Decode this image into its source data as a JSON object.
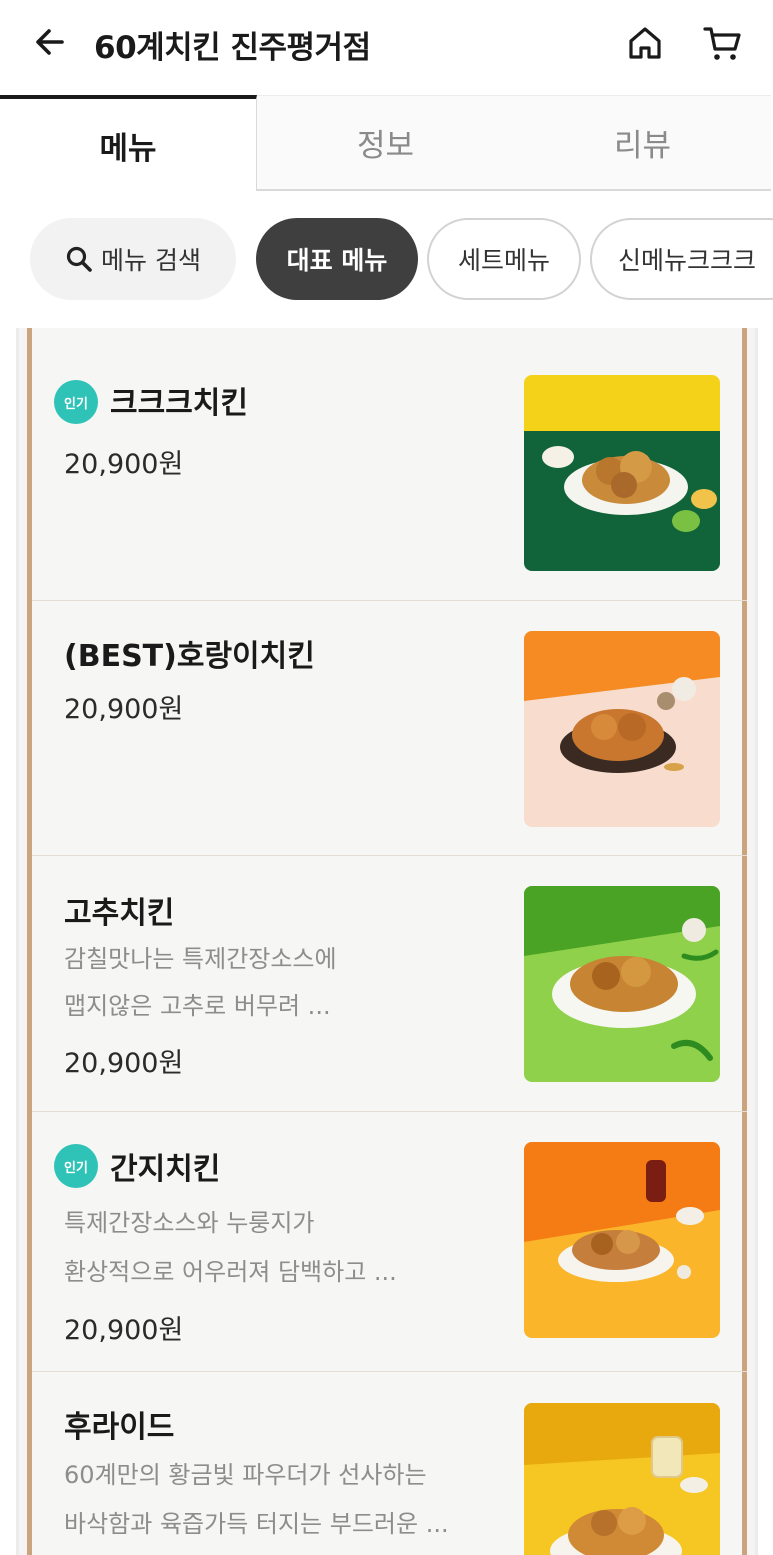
{
  "header": {
    "title": "60계치킨 진주평거점",
    "back_icon": "arrow-left-icon",
    "home_icon": "home-icon",
    "cart_icon": "cart-icon"
  },
  "tabs": [
    {
      "label": "메뉴",
      "active": true
    },
    {
      "label": "정보",
      "active": false
    },
    {
      "label": "리뷰",
      "active": false
    }
  ],
  "chips": {
    "search_label": "메뉴 검색",
    "items": [
      "대표 메뉴",
      "세트메뉴",
      "신메뉴크크크"
    ]
  },
  "colors": {
    "badge": "#2fc3b8",
    "frame_border": "#c9a47f",
    "active_chip": "#3f3f3f"
  },
  "menu": [
    {
      "name": "크크크치킨",
      "badge": "인기",
      "desc": [],
      "price": "20,900원"
    },
    {
      "name": "(BEST)호랑이치킨",
      "badge": "",
      "desc": [],
      "price": "20,900원"
    },
    {
      "name": "고추치킨",
      "badge": "",
      "desc": [
        "감칠맛나는 특제간장소스에",
        "맵지않은 고추로 버무려  ..."
      ],
      "price": "20,900원"
    },
    {
      "name": "간지치킨",
      "badge": "인기",
      "desc": [
        "특제간장소스와 누룽지가",
        "환상적으로 어우러져 담백하고  ..."
      ],
      "price": "20,900원"
    },
    {
      "name": "후라이드",
      "badge": "",
      "desc": [
        "60계만의 황금빛 파우더가 선사하는",
        "바삭함과 육즙가득 터지는 부드러운  ..."
      ],
      "price": ""
    }
  ]
}
